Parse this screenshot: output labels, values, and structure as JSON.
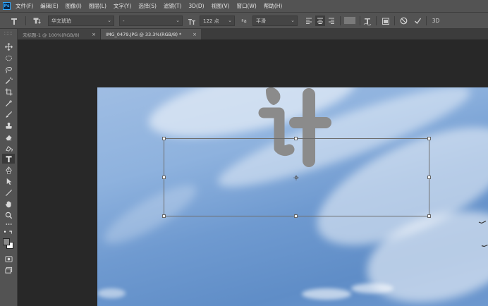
{
  "menubar": {
    "logo": "Ps",
    "items": [
      "文件(F)",
      "编辑(E)",
      "图像(I)",
      "图层(L)",
      "文字(Y)",
      "选择(S)",
      "滤镜(T)",
      "3D(D)",
      "视图(V)",
      "窗口(W)",
      "帮助(H)"
    ]
  },
  "options": {
    "font_family": "华文琥珀",
    "font_style": "-",
    "font_size": "122 点",
    "aa_label": "ªa",
    "antialias": "平滑",
    "mode_3d": "3D"
  },
  "tabs": [
    {
      "label": "未标题-1 @ 100%(RGB/8)",
      "close": "×",
      "active": false
    },
    {
      "label": "IMG_0479.JPG @ 33.3%(RGB/8) *",
      "close": "×",
      "active": true
    }
  ],
  "canvas": {
    "text_layer": "计",
    "text_color": "#8b8b8b"
  },
  "colors": {
    "foreground": "#8a8a8a",
    "background": "#ffffff",
    "panel": "#535353",
    "workspace": "#282828"
  }
}
